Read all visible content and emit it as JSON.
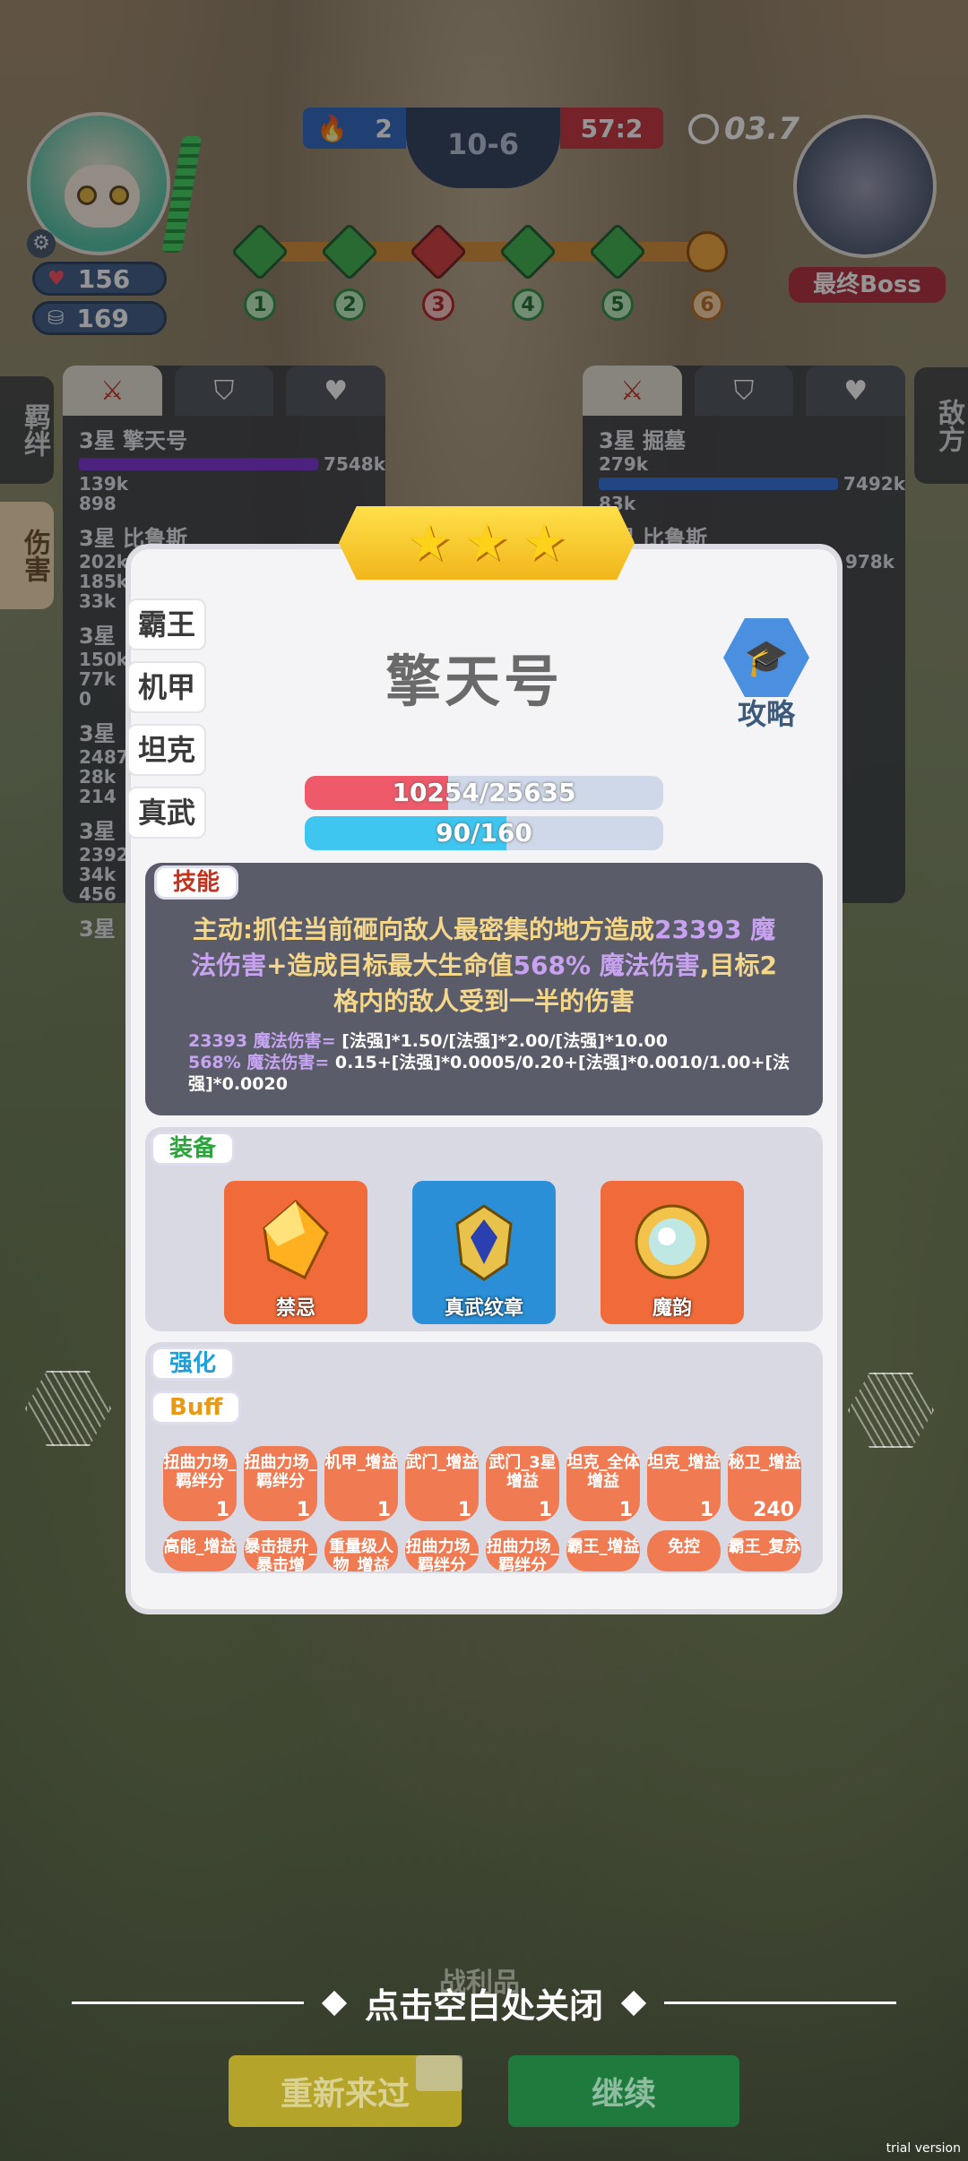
{
  "player": {
    "hp": "156",
    "coins": "169"
  },
  "scoreboard": {
    "left_score": "2",
    "round": "10-6",
    "right_score": "57:2",
    "timer": "03.7"
  },
  "boss": {
    "label": "最终Boss"
  },
  "stages": [
    "1",
    "2",
    "3",
    "4",
    "5",
    "6"
  ],
  "side_tabs": {
    "bond": "羁绊",
    "damage": "伤害",
    "enemy": "敌方"
  },
  "left_panel": {
    "rows": [
      {
        "name": "3星 擎天号",
        "top": "7548k",
        "a": "139k",
        "b": "898"
      },
      {
        "name": "3星 比鲁斯",
        "a": "202k",
        "b": "185k",
        "c": "33k"
      },
      {
        "name": "3星",
        "a": "150k",
        "b": "77k",
        "c": "0"
      },
      {
        "name": "3星",
        "a": "2487",
        "b": "28k",
        "c": "214"
      },
      {
        "name": "3星",
        "a": "2392",
        "b": "34k",
        "c": "456"
      },
      {
        "name": "3星"
      }
    ]
  },
  "right_panel": {
    "rows": [
      {
        "name": "3星 掘墓",
        "a": "279k",
        "top": "7492k",
        "b": "83k"
      },
      {
        "name": "3星 比鲁斯",
        "top": "978k"
      }
    ]
  },
  "modal": {
    "stars": 3,
    "side_list": [
      "霸王",
      "机甲",
      "坦克",
      "真武"
    ],
    "hero_name": "擎天号",
    "guide_label": "攻略",
    "hp_text": "10254/25635",
    "hp_fraction": 0.4,
    "mp_text": "90/160",
    "mp_fraction": 0.5625,
    "skill_tag": "技能",
    "skill_desc_1": "主动:抓住当前砸向敌人最密集的地方造成",
    "skill_hl_1": "23393 魔法伤害",
    "skill_desc_2": "+造成目标最大生命值",
    "skill_hl_2": "568% 魔法伤害",
    "skill_desc_3": ",目标2格内的敌人受到一半的伤害",
    "formula_1_label": "23393 魔法伤害= ",
    "formula_1": "[法强]*1.50/[法强]*2.00/[法强]*10.00",
    "formula_2_label": "568% 魔法伤害= ",
    "formula_2": "0.15+[法强]*0.0005/0.20+[法强]*0.0010/1.00+[法强]*0.0020",
    "equip_tag": "装备",
    "equipment": [
      "禁忌",
      "真武纹章",
      "魔韵"
    ],
    "enhance_tag": "强化",
    "buff_tag": "Buff",
    "buffs_row1": [
      {
        "label": "扭曲力场_羁绊分",
        "n": "1"
      },
      {
        "label": "扭曲力场_羁绊分",
        "n": "1"
      },
      {
        "label": "机甲_增益",
        "n": "1"
      },
      {
        "label": "武门_增益",
        "n": "1"
      },
      {
        "label": "武门_3星增益",
        "n": "1"
      },
      {
        "label": "坦克_全体增益",
        "n": "1"
      },
      {
        "label": "坦克_增益",
        "n": "1"
      },
      {
        "label": "秘卫_增益",
        "n": "240"
      }
    ],
    "buffs_row2": [
      {
        "label": "高能_增益"
      },
      {
        "label": "暴击提升_暴击增"
      },
      {
        "label": "重量级人物_增益"
      },
      {
        "label": "扭曲力场_羁绊分"
      },
      {
        "label": "扭曲力场_羁绊分"
      },
      {
        "label": "霸王_增益"
      },
      {
        "label": "免控"
      },
      {
        "label": "霸王_复苏"
      }
    ]
  },
  "footer": {
    "close_hint": "点击空白处关闭",
    "ghost": "战利品",
    "retry": "重新来过",
    "continue": "继续",
    "trial": "trial version"
  }
}
